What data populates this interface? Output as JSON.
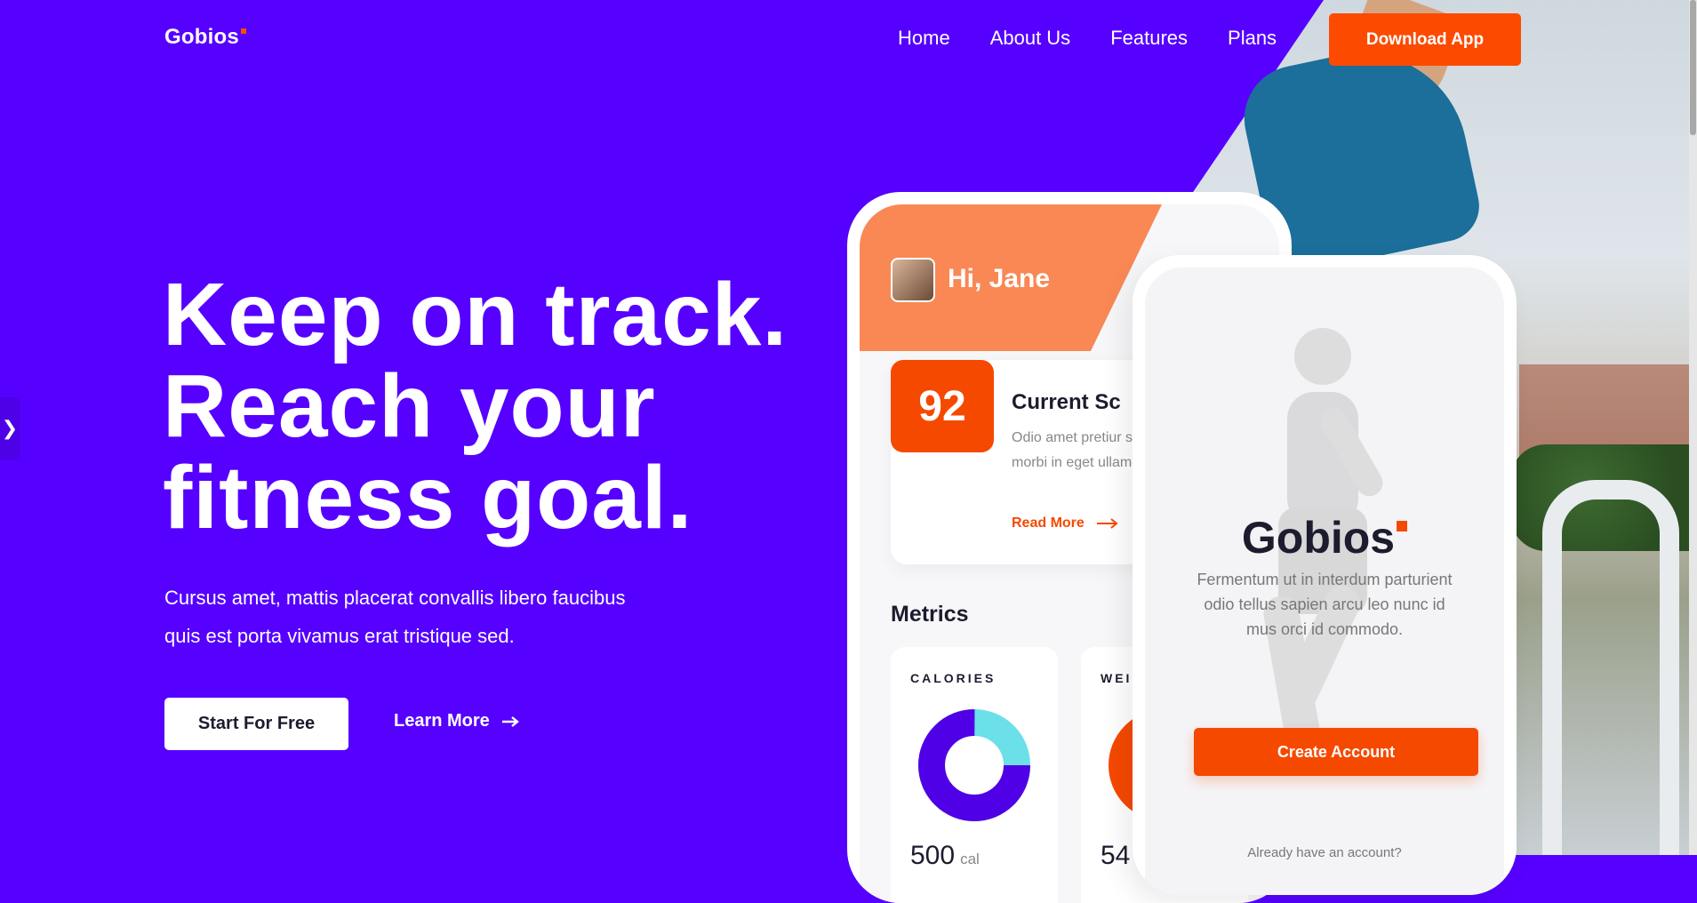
{
  "brand": {
    "name": "Gobios",
    "accent": "#fc4a00",
    "background": "#5600ff"
  },
  "nav": {
    "items": [
      "Home",
      "About Us",
      "Features",
      "Plans"
    ],
    "cta": "Download App"
  },
  "hero": {
    "title_lines": [
      "Keep on track.",
      "Reach your",
      "fitness goal."
    ],
    "subtitle_lines": [
      "Cursus amet, mattis placerat convallis libero faucibus",
      "quis est porta vivamus erat tristique sed."
    ],
    "primary_button": "Start For Free",
    "secondary_button": "Learn More"
  },
  "phone_app": {
    "greeting": "Hi, Jane",
    "score": "92",
    "score_title": "Current Sc",
    "score_desc": "Odio amet pretiur sed nibh morbi in eget ullamcorper",
    "read_more": "Read More",
    "metrics_label": "Metrics",
    "metrics": [
      {
        "title": "CALORIES",
        "value": "500",
        "unit": "cal",
        "fraction": 0.75
      },
      {
        "title": "WEI",
        "value": "54",
        "unit": ""
      }
    ]
  },
  "phone_signup": {
    "logo": "Gobios",
    "description": "Fermentum ut in interdum parturient odio tellus sapien arcu leo nunc id mus orci id commodo.",
    "button": "Create Account",
    "footer": "Already have an account?"
  },
  "icons": {
    "side_arrow": "chevron-right-icon",
    "learn_more": "arrow-right-icon",
    "read_more": "arrow-right-icon"
  }
}
